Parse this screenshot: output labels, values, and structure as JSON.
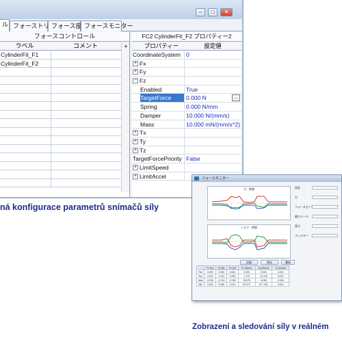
{
  "main_window": {
    "tabs": [
      {
        "label": "ル"
      },
      {
        "label": "フォーストリガー"
      },
      {
        "label": "フォース座標"
      },
      {
        "label": "フォースモニター"
      }
    ],
    "window_controls": {
      "minimize": "–",
      "maximize": "□",
      "close": "✕"
    },
    "left_panel": {
      "title": "フォースコントロール",
      "col_label": "ラベル",
      "col_comment": "コメント",
      "scroll_icon": "plus-icon",
      "rows": [
        {
          "label": "CylinderFit_F1"
        },
        {
          "label": "CylinderFit_F2"
        },
        {
          "label": ""
        },
        {
          "label": ""
        },
        {
          "label": ""
        },
        {
          "label": ""
        },
        {
          "label": ""
        },
        {
          "label": ""
        },
        {
          "label": ""
        },
        {
          "label": ""
        },
        {
          "label": ""
        },
        {
          "label": ""
        },
        {
          "label": ""
        },
        {
          "label": ""
        },
        {
          "label": ""
        },
        {
          "label": ""
        }
      ]
    },
    "property_panel": {
      "title": "FC2 CylinderFit_F2 プロパティー2",
      "col_property": "プロパティー",
      "col_value": "設定値",
      "rows": [
        {
          "name": "CoordinateSystem",
          "value": "0",
          "expander": "",
          "indent": false
        },
        {
          "name": "Fx",
          "value": "",
          "expander": "+",
          "indent": false
        },
        {
          "name": "Fy",
          "value": "",
          "expander": "+",
          "indent": false
        },
        {
          "name": "Fz",
          "value": "",
          "expander": "−",
          "indent": false
        },
        {
          "name": "Enabled",
          "value": "True",
          "expander": "",
          "indent": true
        },
        {
          "name": "TargetForce",
          "value": "0.000 N",
          "expander": "",
          "indent": true,
          "selected": true
        },
        {
          "name": "Spring",
          "value": "0.000 N/mm",
          "expander": "",
          "indent": true
        },
        {
          "name": "Damper",
          "value": "10.000 N/(mm/s)",
          "expander": "",
          "indent": true
        },
        {
          "name": "Mass",
          "value": "10.000 mN/(mm/s^2)",
          "expander": "",
          "indent": true
        },
        {
          "name": "Tx",
          "value": "",
          "expander": "+",
          "indent": false
        },
        {
          "name": "Ty",
          "value": "",
          "expander": "+",
          "indent": false
        },
        {
          "name": "Tz",
          "value": "",
          "expander": "+",
          "indent": false
        },
        {
          "name": "TargetForcePriority",
          "value": "False",
          "expander": "",
          "indent": false
        },
        {
          "name": "LimitSpeed",
          "value": "",
          "expander": "+",
          "indent": false
        },
        {
          "name": "LimitAccel",
          "value": "",
          "expander": "+",
          "indent": false
        }
      ],
      "ellipsis": "..."
    }
  },
  "caption_left": "ná konfigurace parametrů snímačů síly",
  "monitor_window": {
    "title": "フォースモニター",
    "chart1_title": "力 - 時間",
    "chart2_title": "トルク - 時間",
    "side_labels": [
      "設定",
      "力",
      "フォースセンサー",
      "最大データ",
      "表示",
      "フィルター"
    ],
    "buttons": [
      "記録",
      "保存",
      "開始"
    ],
    "table_header": [
      "",
      "Fx (N)",
      "Fy (N)",
      "Fz (N)",
      "Tx (Nmm)",
      "Ty (Nmm)",
      "Tz (Nmm)"
    ],
    "table_rows": [
      [
        "Ref",
        "0.000",
        "0.000",
        "0.000",
        "0.000",
        "0.000",
        "0.000"
      ],
      [
        "Ave",
        "0.013",
        "-0.021",
        "0.005",
        "1.170",
        "-10.375",
        "0.029"
      ],
      [
        "Max",
        "-0.910",
        "-0.710",
        "-0.392",
        "76.075",
        "-6.080",
        "-0.004"
      ],
      [
        "Min",
        "0.020",
        "0.066",
        "0.013",
        "702.077",
        "677.320",
        "2.002"
      ]
    ],
    "series_colors": {
      "Fx": "#d9342b",
      "Fy": "#2a9a3c",
      "Fz": "#2b56c9"
    }
  },
  "caption_right": "Zobrazení a sledování síly v reálném"
}
